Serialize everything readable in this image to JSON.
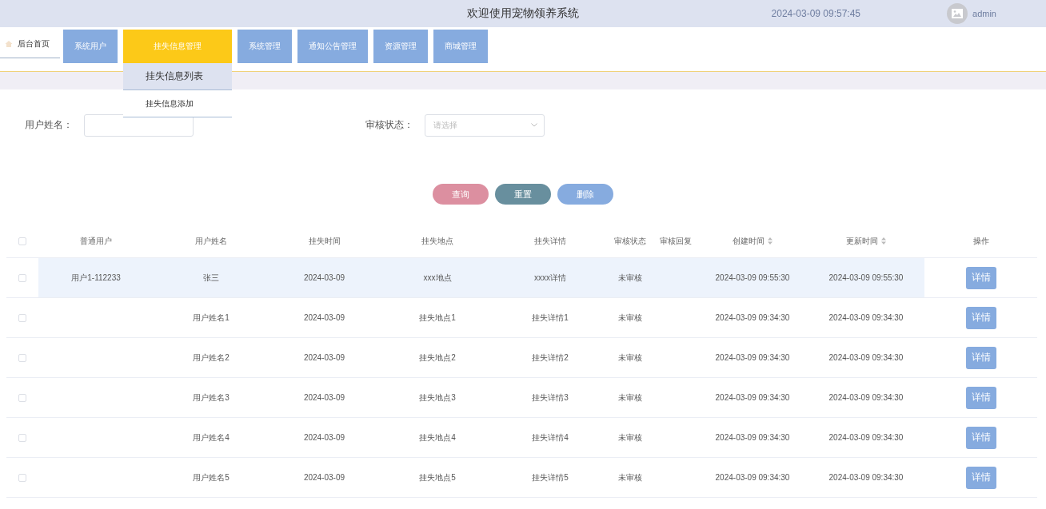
{
  "header": {
    "title": "欢迎使用宠物领养系统",
    "time": "2024-03-09 09:57:45",
    "user": "admin"
  },
  "nav": {
    "home": "后台首页",
    "menus": [
      {
        "label": "系统用户",
        "selected": false
      },
      {
        "label": "挂失信息管理",
        "selected": true,
        "submenu": [
          {
            "label": "挂失信息列表",
            "selected": true
          },
          {
            "label": "挂失信息添加",
            "selected": false
          }
        ]
      },
      {
        "label": "系统管理",
        "selected": false
      },
      {
        "label": "通知公告管理",
        "selected": false
      },
      {
        "label": "资源管理",
        "selected": false
      },
      {
        "label": "商城管理",
        "selected": false
      }
    ]
  },
  "filters": [
    {
      "label": "用户姓名：",
      "kind": "input"
    },
    {
      "label": "审核状态：",
      "kind": "select",
      "placeholder": "请选择"
    }
  ],
  "actions": [
    {
      "label": "查询",
      "color": "#dc8fa0"
    },
    {
      "label": "重置",
      "color": "#688f9e"
    },
    {
      "label": "删除",
      "color": "#86abdf"
    }
  ],
  "table": {
    "all_checked": false,
    "columns": [
      {
        "label": "普通用户",
        "sortable": false
      },
      {
        "label": "用户姓名",
        "sortable": false
      },
      {
        "label": "挂失时间",
        "sortable": false
      },
      {
        "label": "挂失地点",
        "sortable": false
      },
      {
        "label": "挂失详情",
        "sortable": false
      },
      {
        "label": "审核状态",
        "sortable": false
      },
      {
        "label": "审核回复",
        "sortable": false
      },
      {
        "label": "创建时间",
        "sortable": true
      },
      {
        "label": "更新时间",
        "sortable": true
      },
      {
        "label": "操作",
        "sortable": false
      }
    ],
    "rows": [
      {
        "checked": false,
        "highlighted": true,
        "cells": [
          "用户1-112233",
          "张三",
          "2024-03-09",
          "xxx地点",
          "xxxx详情",
          "未审核",
          "",
          "2024-03-09 09:55:30",
          "2024-03-09 09:55:30"
        ],
        "action": "详情"
      },
      {
        "checked": false,
        "highlighted": false,
        "cells": [
          "",
          "用户姓名1",
          "2024-03-09",
          "挂失地点1",
          "挂失详情1",
          "未审核",
          "",
          "2024-03-09 09:34:30",
          "2024-03-09 09:34:30"
        ],
        "action": "详情"
      },
      {
        "checked": false,
        "highlighted": false,
        "cells": [
          "",
          "用户姓名2",
          "2024-03-09",
          "挂失地点2",
          "挂失详情2",
          "未审核",
          "",
          "2024-03-09 09:34:30",
          "2024-03-09 09:34:30"
        ],
        "action": "详情"
      },
      {
        "checked": false,
        "highlighted": false,
        "cells": [
          "",
          "用户姓名3",
          "2024-03-09",
          "挂失地点3",
          "挂失详情3",
          "未审核",
          "",
          "2024-03-09 09:34:30",
          "2024-03-09 09:34:30"
        ],
        "action": "详情"
      },
      {
        "checked": false,
        "highlighted": false,
        "cells": [
          "",
          "用户姓名4",
          "2024-03-09",
          "挂失地点4",
          "挂失详情4",
          "未审核",
          "",
          "2024-03-09 09:34:30",
          "2024-03-09 09:34:30"
        ],
        "action": "详情"
      },
      {
        "checked": false,
        "highlighted": false,
        "cells": [
          "",
          "用户姓名5",
          "2024-03-09",
          "挂失地点5",
          "挂失详情5",
          "未审核",
          "",
          "2024-03-09 09:34:30",
          "2024-03-09 09:34:30"
        ],
        "action": "详情"
      }
    ]
  }
}
